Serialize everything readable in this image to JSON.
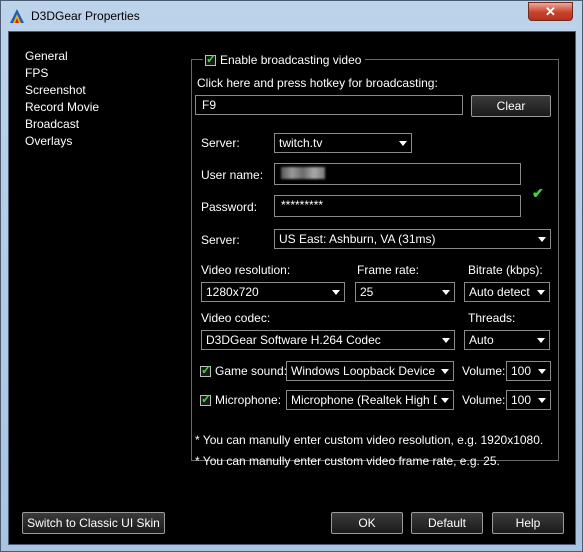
{
  "window": {
    "title": "D3DGear Properties",
    "close_label": "✕"
  },
  "sidebar": {
    "items": [
      {
        "label": "General"
      },
      {
        "label": "FPS"
      },
      {
        "label": "Screenshot"
      },
      {
        "label": "Record Movie"
      },
      {
        "label": "Broadcast"
      },
      {
        "label": "Overlays"
      }
    ]
  },
  "broadcast": {
    "enable_label": "Enable broadcasting video",
    "enable_checked": true,
    "hotkey_label": "Click here and press hotkey for broadcasting:",
    "hotkey_value": "F9",
    "clear_label": "Clear",
    "server_label": "Server:",
    "server_value": "twitch.tv",
    "username_label": "User name:",
    "password_label": "Password:",
    "password_value": "*********",
    "ingest_label": "Server:",
    "ingest_value": "US East: Ashburn, VA    (31ms)",
    "resolution_label": "Video resolution:",
    "resolution_value": "1280x720",
    "framerate_label": "Frame rate:",
    "framerate_value": "25",
    "bitrate_label": "Bitrate (kbps):",
    "bitrate_value": "Auto detect",
    "codec_label": "Video codec:",
    "codec_value": "D3DGear Software H.264 Codec",
    "threads_label": "Threads:",
    "threads_value": "Auto",
    "game_sound_label": "Game sound:",
    "game_sound_checked": true,
    "game_sound_device": "Windows Loopback Device",
    "game_volume_label": "Volume:",
    "game_volume_value": "100",
    "mic_label": "Microphone:",
    "mic_checked": true,
    "mic_device": "Microphone (Realtek High Definition",
    "mic_volume_label": "Volume:",
    "mic_volume_value": "100"
  },
  "notes": [
    "* You can manully enter custom video resolution, e.g. 1920x1080.",
    "* You can manully enter custom video frame rate, e.g. 25."
  ],
  "footer": {
    "classic_label": "Switch to Classic UI Skin",
    "ok_label": "OK",
    "default_label": "Default",
    "help_label": "Help"
  },
  "icons": {
    "app": "d3dgear-app-icon",
    "login_status": "green-checkmark-icon"
  },
  "colors": {
    "check_green": "#3fd43f",
    "background": "#000000",
    "text": "#ffffff"
  }
}
